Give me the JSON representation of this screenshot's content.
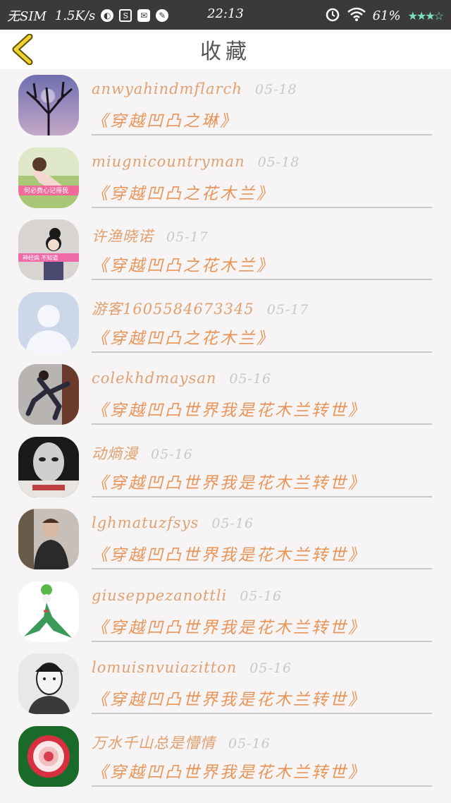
{
  "status_bar": {
    "carrier": "无SIM",
    "speed": "1.5K/s",
    "time": "22:13",
    "battery": "61%"
  },
  "header": {
    "title": "收藏"
  },
  "favorites": [
    {
      "user": "anwyahindmflarch",
      "date": "05-18",
      "title": "《穿越凹凸之琳》",
      "avatar": "tree"
    },
    {
      "user": "miugnicountryman",
      "date": "05-18",
      "title": "《穿越凹凸之花木兰》",
      "avatar": "girl-pink"
    },
    {
      "user": "许渔晓诺",
      "date": "05-17",
      "title": "《穿越凹凸之花木兰》",
      "avatar": "girl-bun"
    },
    {
      "user": "游客1605584673345",
      "date": "05-17",
      "title": "《穿越凹凸之花木兰》",
      "avatar": "default-user"
    },
    {
      "user": "colekhdmaysan",
      "date": "05-16",
      "title": "《穿越凹凸世界我是花木兰转世》",
      "avatar": "runner"
    },
    {
      "user": "动熵漫",
      "date": "05-16",
      "title": "《穿越凹凸世界我是花木兰转世》",
      "avatar": "face-bw"
    },
    {
      "user": "lghmatuzfsys",
      "date": "05-16",
      "title": "《穿越凹凸世界我是花木兰转世》",
      "avatar": "man-suit"
    },
    {
      "user": "giuseppezanottli",
      "date": "05-16",
      "title": "《穿越凹凸世界我是花木兰转世》",
      "avatar": "gardevoir"
    },
    {
      "user": "lomuisnvuiazitton",
      "date": "05-16",
      "title": "《穿越凹凸世界我是花木兰转世》",
      "avatar": "boy-sketch"
    },
    {
      "user": "万水千山总是懵情",
      "date": "05-16",
      "title": "《穿越凹凸世界我是花木兰转世》",
      "avatar": "rose"
    }
  ]
}
